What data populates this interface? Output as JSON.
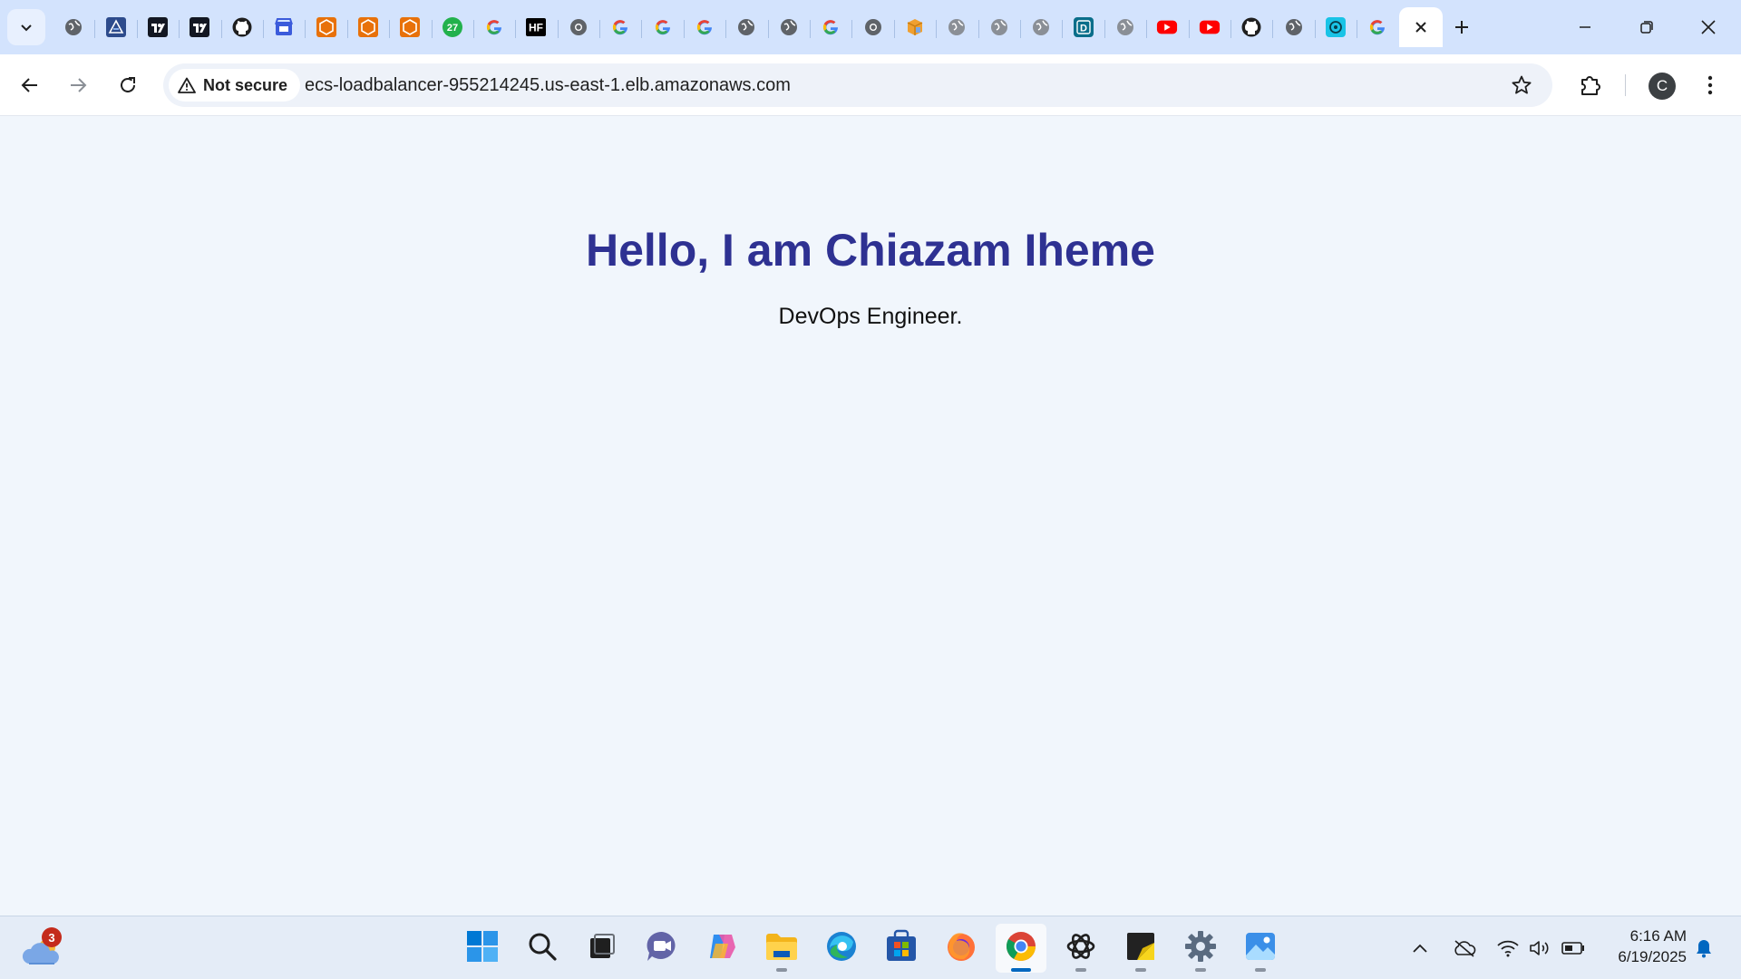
{
  "browser": {
    "tabs": [
      {
        "icon": "globe-icon",
        "color": "#5f6368"
      },
      {
        "icon": "cloudformation-icon",
        "color": "#2d4b8c"
      },
      {
        "icon": "tradingview-icon",
        "color": "#131722"
      },
      {
        "icon": "tradingview-icon",
        "color": "#131722"
      },
      {
        "icon": "github-icon",
        "color": "#1f1f1f"
      },
      {
        "icon": "store-icon",
        "color": "#3b5bdb"
      },
      {
        "icon": "aws-orange-icon",
        "color": "#e8710a"
      },
      {
        "icon": "aws-orange-icon",
        "color": "#e8710a"
      },
      {
        "icon": "aws-orange-icon",
        "color": "#e8710a"
      },
      {
        "icon": "badge-27-icon",
        "color": "#22b14c",
        "text": "27"
      },
      {
        "icon": "google-icon",
        "color": "#4285f4"
      },
      {
        "icon": "huggingface-hf-icon",
        "color": "#000000",
        "text": "HF"
      },
      {
        "icon": "chrome-gray-icon",
        "color": "#5f6368"
      },
      {
        "icon": "google-icon",
        "color": "#4285f4"
      },
      {
        "icon": "google-icon",
        "color": "#4285f4"
      },
      {
        "icon": "google-icon",
        "color": "#4285f4"
      },
      {
        "icon": "globe-icon",
        "color": "#5f6368"
      },
      {
        "icon": "globe-icon",
        "color": "#5f6368"
      },
      {
        "icon": "google-icon",
        "color": "#4285f4"
      },
      {
        "icon": "chrome-gray-icon",
        "color": "#5f6368"
      },
      {
        "icon": "aws-box-icon",
        "color": "#f0a030"
      },
      {
        "icon": "globe-icon",
        "color": "#8a8f96"
      },
      {
        "icon": "globe-icon",
        "color": "#8a8f96"
      },
      {
        "icon": "globe-icon",
        "color": "#8a8f96"
      },
      {
        "icon": "d-app-icon",
        "color": "#0a6e8a",
        "text": "D"
      },
      {
        "icon": "globe-icon",
        "color": "#8a8f96"
      },
      {
        "icon": "youtube-icon",
        "color": "#ff0000"
      },
      {
        "icon": "youtube-icon",
        "color": "#ff0000"
      },
      {
        "icon": "github-icon",
        "color": "#1f1f1f"
      },
      {
        "icon": "globe-icon",
        "color": "#5f6368"
      },
      {
        "icon": "openai-cyan-icon",
        "color": "#19c3e6"
      },
      {
        "icon": "google-icon",
        "color": "#4285f4"
      },
      {
        "icon": "close-icon",
        "color": "#1f1f1f",
        "active": true
      }
    ],
    "security_label": "Not secure",
    "url": "ecs-loadbalancer-955214245.us-east-1.elb.amazonaws.com",
    "profile_initial": "C",
    "accent": "#d3e3fd"
  },
  "page": {
    "title": "Hello, I am Chiazam Iheme",
    "subtitle": "DevOps Engineer.",
    "title_color": "#2e3192",
    "background": "#f1f6fc"
  },
  "taskbar": {
    "weather_badge": "3",
    "apps": [
      {
        "name": "start-button",
        "icon": "windows-icon"
      },
      {
        "name": "search-button",
        "icon": "search-icon"
      },
      {
        "name": "task-view-button",
        "icon": "task-view-icon"
      },
      {
        "name": "chat-app",
        "icon": "chat-icon"
      },
      {
        "name": "copilot-app",
        "icon": "copilot-icon"
      },
      {
        "name": "file-explorer-app",
        "icon": "folder-icon",
        "running": true
      },
      {
        "name": "edge-app",
        "icon": "edge-icon"
      },
      {
        "name": "store-app",
        "icon": "store-icon"
      },
      {
        "name": "firefox-app",
        "icon": "firefox-icon"
      },
      {
        "name": "chrome-app",
        "icon": "chrome-icon",
        "running": true,
        "active": true
      },
      {
        "name": "chatgpt-app",
        "icon": "chatgpt-icon",
        "running": true
      },
      {
        "name": "sticky-notes-app",
        "icon": "sticky-notes-icon",
        "running": true
      },
      {
        "name": "settings-app",
        "icon": "gear-icon",
        "running": true
      },
      {
        "name": "photos-app",
        "icon": "photos-icon",
        "running": true
      }
    ],
    "time": "6:16 AM",
    "date": "6/19/2025"
  }
}
